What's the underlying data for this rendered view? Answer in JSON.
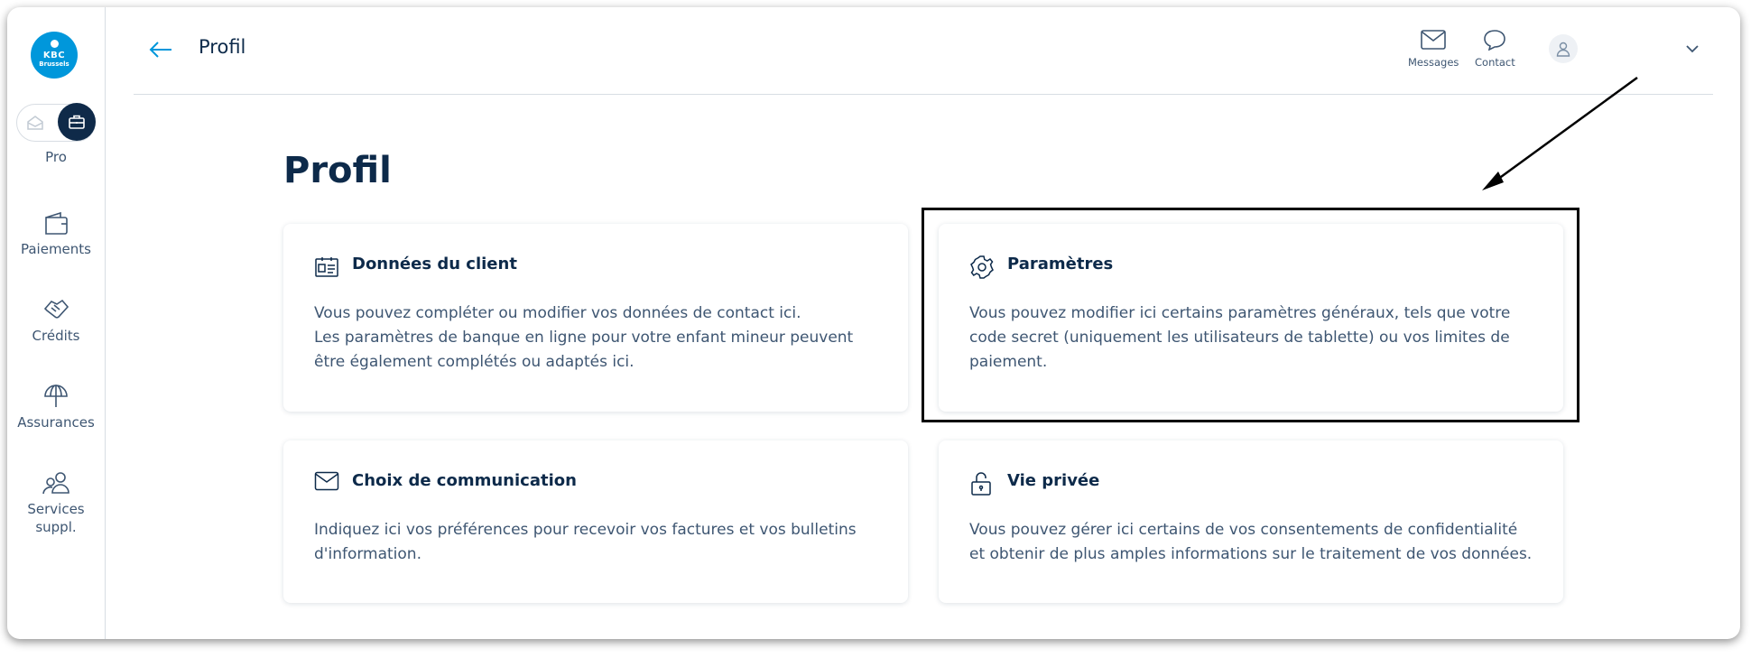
{
  "sidebar": {
    "logo": {
      "line1": "KBC",
      "line2": "Brussels"
    },
    "toggle_label": "Pro",
    "items": [
      {
        "label": "Paiements",
        "icon": "wallet-icon"
      },
      {
        "label": "Crédits",
        "icon": "handshake-icon"
      },
      {
        "label": "Assurances",
        "icon": "umbrella-icon"
      },
      {
        "label": "Services\nsuppl.",
        "icon": "users-icon"
      }
    ]
  },
  "header": {
    "title": "Profil",
    "messages_label": "Messages",
    "contact_label": "Contact"
  },
  "main": {
    "title": "Profil",
    "cards": [
      {
        "title": "Données du client",
        "icon": "id-card-icon",
        "description": "Vous pouvez compléter ou modifier vos données de contact ici.\nLes paramètres de banque en ligne pour votre enfant mineur peuvent\nêtre également complétés ou adaptés ici."
      },
      {
        "title": "Paramètres",
        "icon": "gear-icon",
        "description": "Vous pouvez modifier ici certains paramètres généraux, tels que votre\ncode secret (uniquement les utilisateurs de tablette) ou vos limites de\npaiement."
      },
      {
        "title": "Choix de communication",
        "icon": "envelope-icon",
        "description": "Indiquez ici vos préférences pour recevoir vos factures et vos bulletins\nd'information."
      },
      {
        "title": "Vie privée",
        "icon": "unlock-icon",
        "description": "Vous pouvez gérer ici certains de vos consentements de confidentialité\net obtenir de plus amples informations sur le traitement de vos données."
      }
    ]
  },
  "colors": {
    "brand_blue": "#0097db",
    "navy": "#0d2a4a",
    "text_muted": "#3e5672",
    "divider": "#d8dde3",
    "annotation": "#000000"
  }
}
